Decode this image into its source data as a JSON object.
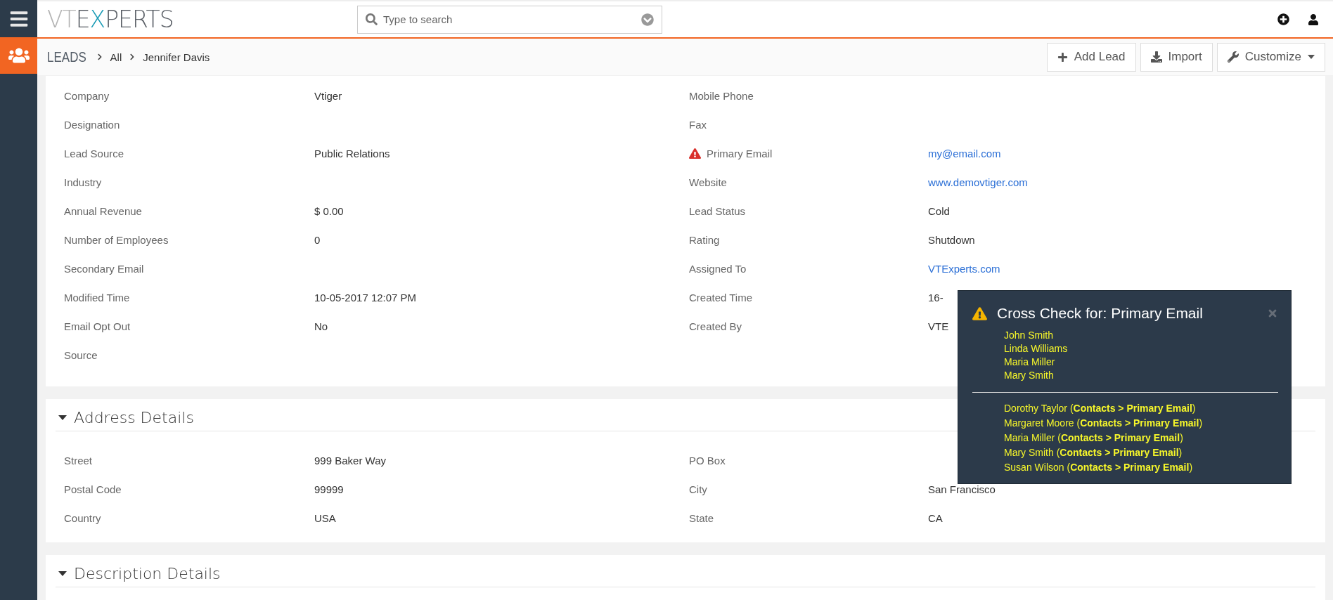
{
  "logo": [
    {
      "text": "VT",
      "color": "#b3b3b3"
    },
    {
      "text": "E",
      "color": "#5a5f66"
    },
    {
      "text": "X",
      "color": "#1a9bb5"
    },
    {
      "text": "PERTS",
      "color": "#5a5f66"
    }
  ],
  "search": {
    "placeholder": "Type to search"
  },
  "breadcrumb": {
    "module": "LEADS",
    "items": [
      "All",
      "Jennifer Davis"
    ]
  },
  "actions": [
    {
      "kind": "add",
      "label": "Add Lead"
    },
    {
      "kind": "import",
      "label": "Import"
    },
    {
      "kind": "customize",
      "label": "Customize"
    }
  ],
  "details": [
    {
      "left": {
        "label": "Company",
        "value": "Vtiger"
      },
      "right": {
        "label": "Mobile Phone"
      }
    },
    {
      "left": {
        "label": "Designation"
      },
      "right": {
        "label": "Fax"
      }
    },
    {
      "left": {
        "label": "Lead Source",
        "value": "Public Relations"
      },
      "right": {
        "label": "Primary Email",
        "value": "my@email.com",
        "link": true,
        "warning": true
      }
    },
    {
      "left": {
        "label": "Industry"
      },
      "right": {
        "label": "Website",
        "value": "www.demovtiger.com",
        "link": true
      }
    },
    {
      "left": {
        "label": "Annual Revenue",
        "value": "$ 0.00"
      },
      "right": {
        "label": "Lead Status",
        "value": "Cold"
      }
    },
    {
      "left": {
        "label": "Number of Employees",
        "value": "0"
      },
      "right": {
        "label": "Rating",
        "value": "Shutdown"
      }
    },
    {
      "left": {
        "label": "Secondary Email"
      },
      "right": {
        "label": "Assigned To",
        "value": "VTExperts.com",
        "link": true
      }
    },
    {
      "left": {
        "label": "Modified Time",
        "value": "10-05-2017 12:07 PM"
      },
      "right": {
        "label": "Created Time",
        "value": "16-"
      }
    },
    {
      "left": {
        "label": "Email Opt Out",
        "value": "No"
      },
      "right": {
        "label": "Created By",
        "value": "VTE"
      }
    },
    {
      "left": {
        "label": "Source"
      }
    }
  ],
  "sections": [
    {
      "title": "Address Details",
      "expanded": true,
      "rows": [
        {
          "left": {
            "label": "Street",
            "value": "999 Baker Way"
          },
          "right": {
            "label": "PO Box"
          }
        },
        {
          "left": {
            "label": "Postal Code",
            "value": "99999"
          },
          "right": {
            "label": "City",
            "value": "San Francisco"
          }
        },
        {
          "left": {
            "label": "Country",
            "value": "USA"
          },
          "right": {
            "label": "State",
            "value": "CA"
          }
        }
      ]
    },
    {
      "title": "Description Details",
      "expanded": true
    }
  ],
  "popup": {
    "title": "Cross Check for: Primary Email",
    "matches": [
      "John Smith",
      "Linda Williams",
      "Maria Miller",
      "Mary Smith"
    ],
    "related": [
      "Dorothy Taylor (**Contacts > Primary Email**)",
      "Margaret Moore (**Contacts > Primary Email**)",
      "Maria Miller (**Contacts > Primary Email**)",
      "Mary Smith (**Contacts > Primary Email**)",
      "Susan Wilson (**Contacts > Primary Email**)"
    ]
  }
}
